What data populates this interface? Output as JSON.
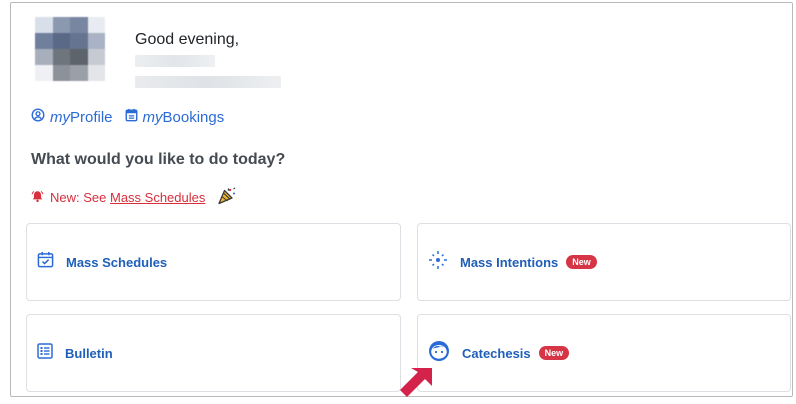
{
  "header": {
    "greeting": "Good evening,"
  },
  "links": {
    "profile_prefix": "my",
    "profile_suffix": "Profile",
    "bookings_prefix": "my",
    "bookings_suffix": "Bookings"
  },
  "prompt": "What would you like to do today?",
  "notice": {
    "prefix": "New: See ",
    "link_text": "Mass Schedules"
  },
  "cards": {
    "mass_schedules": "Mass Schedules",
    "mass_intentions": "Mass Intentions",
    "bulletin": "Bulletin",
    "catechesis": "Catechesis",
    "new_badge": "New"
  },
  "colors": {
    "accent": "#2b6bd6",
    "card_text": "#1f5fb8",
    "badge": "#d63545",
    "notice": "#d72f3c",
    "arrow": "#d4234a"
  },
  "icons": {
    "profile": "user-circle-icon",
    "bookings": "calendar-list-icon",
    "notice": "bell-icon",
    "party": "party-popper-icon",
    "mass_schedules": "calendar-check-icon",
    "mass_intentions": "sparkle-icon",
    "bulletin": "list-box-icon",
    "catechesis": "child-face-icon"
  }
}
